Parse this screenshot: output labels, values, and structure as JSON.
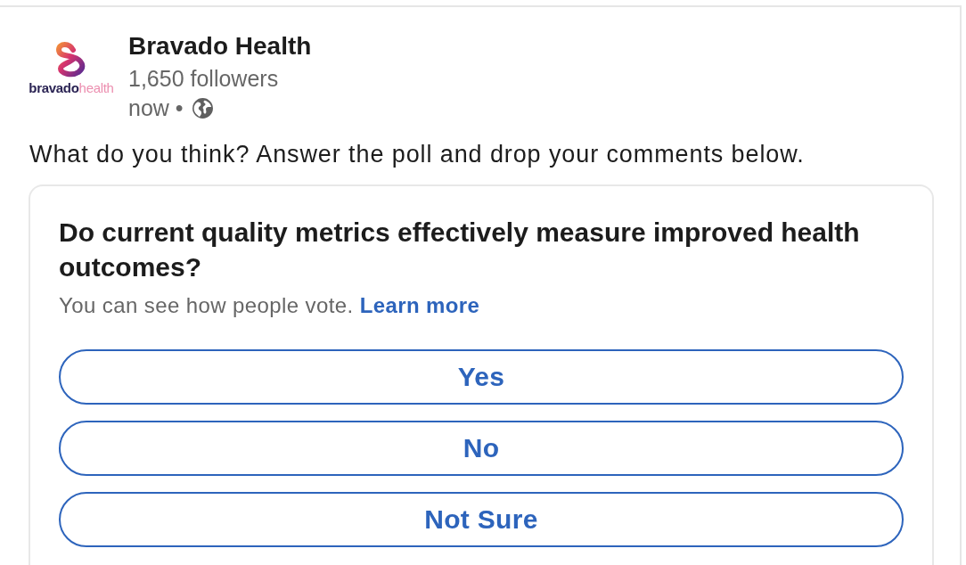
{
  "post": {
    "author": {
      "logo": {
        "wordmark": "bravado",
        "wordmark_suffix": "health"
      },
      "name": "Bravado Health",
      "followers": "1,650 followers",
      "time": "now •"
    },
    "text": "What do you think? Answer the poll and drop your comments below."
  },
  "poll": {
    "question": "Do current quality metrics effectively measure improved health outcomes?",
    "note": "You can see how people vote.",
    "link": "Learn more",
    "options": [
      {
        "label": "Yes",
        "selected": false
      },
      {
        "label": "No",
        "selected": false
      },
      {
        "label": "Not Sure",
        "selected": false
      }
    ]
  }
}
